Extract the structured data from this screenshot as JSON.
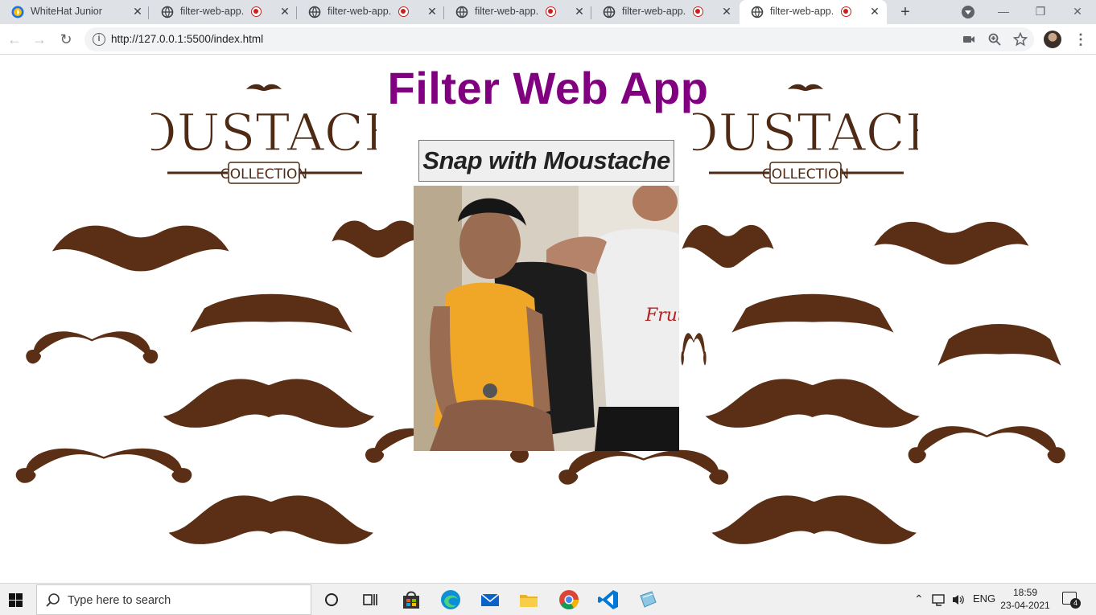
{
  "browser": {
    "tabs": [
      {
        "title": "WhiteHat Junior",
        "active": false,
        "recording": false
      },
      {
        "title": "filter-web-app.",
        "active": false,
        "recording": true
      },
      {
        "title": "filter-web-app.",
        "active": false,
        "recording": true
      },
      {
        "title": "filter-web-app.",
        "active": false,
        "recording": true
      },
      {
        "title": "filter-web-app.",
        "active": false,
        "recording": true
      },
      {
        "title": "filter-web-app.",
        "active": true,
        "recording": true
      }
    ],
    "address": "http://127.0.0.1:5500/index.html"
  },
  "page": {
    "title": "Filter Web App",
    "snap_button": "Snap with Moustache",
    "logo": {
      "word": "MOUSTACHE",
      "sub": "COLLECTION"
    },
    "colors": {
      "title": "#800080",
      "moustache_dark": "#4e2a14",
      "moustache_mid": "#7a4220",
      "moustache_light": "#a4622f"
    }
  },
  "taskbar": {
    "search_placeholder": "Type here to search",
    "language": "ENG",
    "time": "18:59",
    "date": "23-04-2021",
    "notification_count": "4",
    "apps": [
      "task-view-icon",
      "store-icon",
      "edge-icon",
      "mail-icon",
      "file-explorer-icon",
      "chrome-icon",
      "vscode-icon",
      "notepad-icon"
    ]
  }
}
